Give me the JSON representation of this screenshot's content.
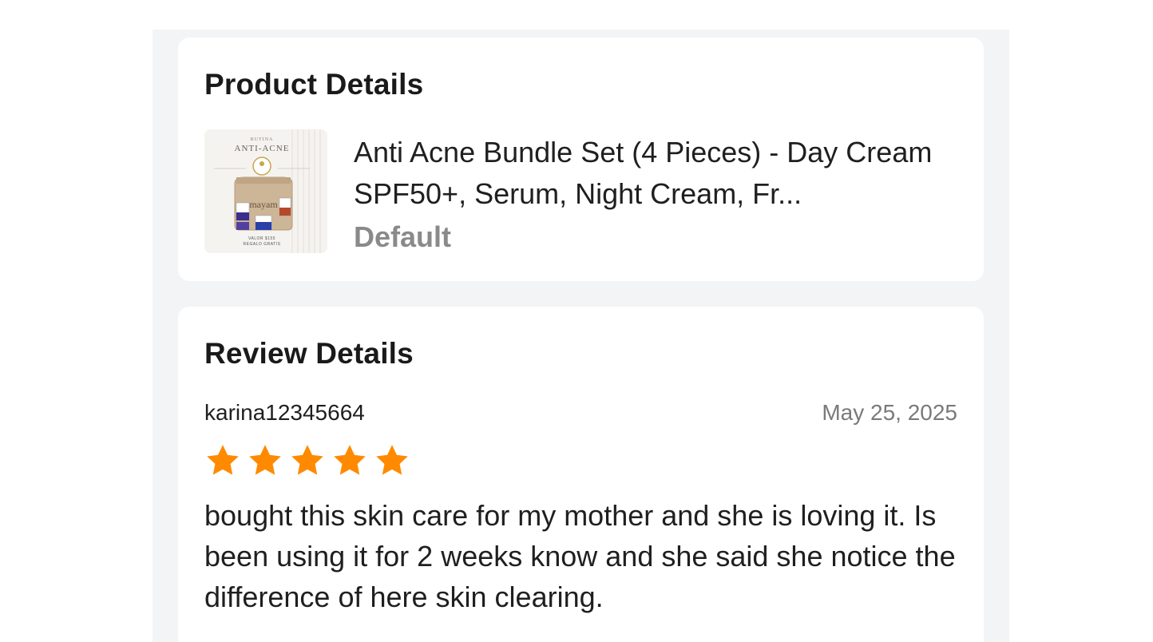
{
  "product_card": {
    "title": "Product Details",
    "product_name": "Anti Acne Bundle Set (4 Pieces) - Day Cream SPF50+, Serum, Night Cream, Fr...",
    "variant": "Default",
    "thumbnail": {
      "brand_line": "RUTINA",
      "headline": "ANTI-ACNE",
      "logo_text": "mayam",
      "footer_line1": "VALOR $155",
      "footer_line2": "REGALO GRATIS"
    }
  },
  "review_card": {
    "title": "Review Details",
    "reviewer": "karina12345664",
    "date": "May 25, 2025",
    "rating": 5,
    "rating_max": 5,
    "text": "bought this skin care for my mother and she is loving it. Is been using it for 2 weeks know and she said she notice the difference of here skin clearing."
  },
  "colors": {
    "star": "#ff8a00",
    "panel_bg": "#f3f4f6",
    "card_bg": "#ffffff",
    "muted_text": "#8a8a8a"
  },
  "icons": {
    "star": "star-icon"
  }
}
